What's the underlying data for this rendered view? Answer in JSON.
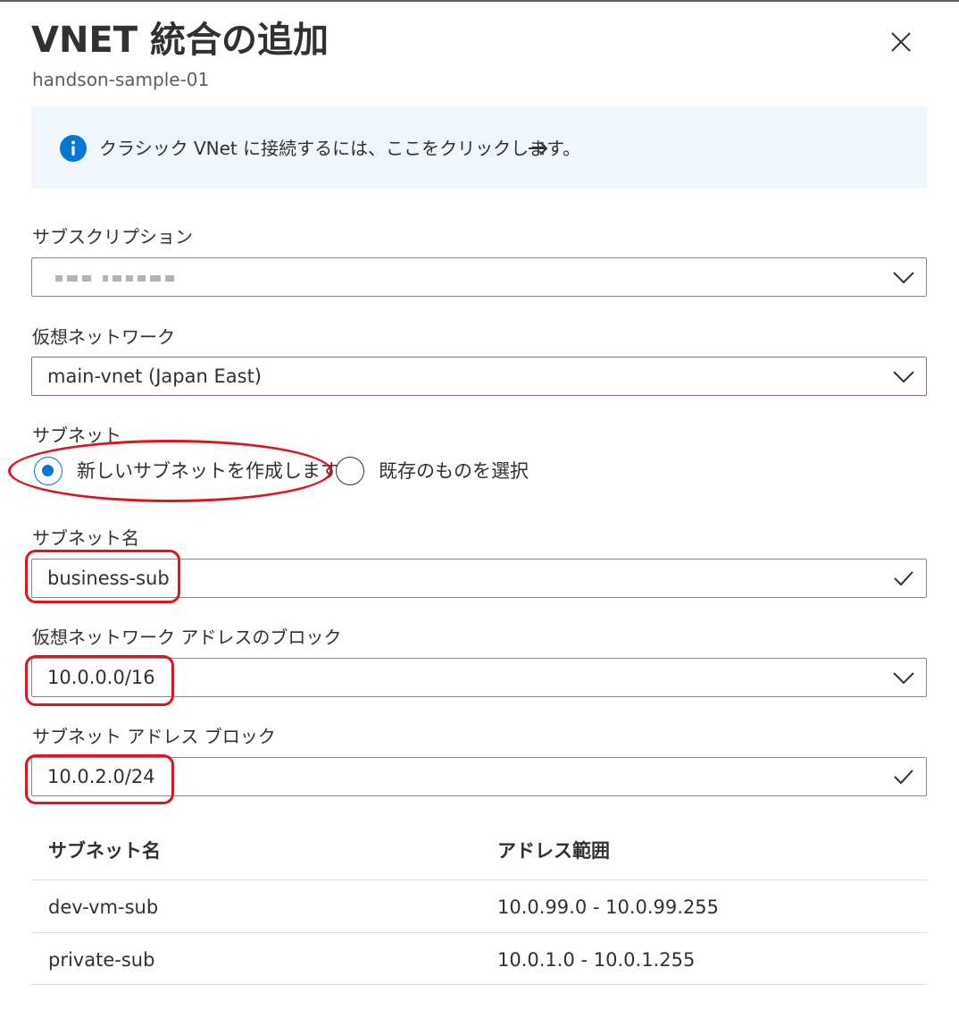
{
  "header": {
    "title": "VNET 統合の追加",
    "subtitle": "handson-sample-01",
    "close_icon": "close-icon"
  },
  "info_bar": {
    "icon": "info-icon",
    "text": "クラシック VNet に接続するには、ここをクリックします。",
    "arrow_icon": "arrow-right-icon",
    "accent_color": "#0078d4",
    "background_color": "#eff6fc"
  },
  "form": {
    "subscription": {
      "label": "サブスクリプション",
      "value_redacted": true,
      "icon": "chevron-down-icon"
    },
    "virtual_network": {
      "label": "仮想ネットワーク",
      "value": "main-vnet (Japan East)",
      "icon": "chevron-down-icon"
    },
    "subnet": {
      "label": "サブネット",
      "options": [
        {
          "label": "新しいサブネットを作成します",
          "checked": true
        },
        {
          "label": "既存のものを選択",
          "checked": false
        }
      ]
    },
    "subnet_name": {
      "label": "サブネット名",
      "value": "business-sub",
      "icon": "checkmark-icon"
    },
    "vnet_address_block": {
      "label": "仮想ネットワーク アドレスのブロック",
      "value": "10.0.0.0/16",
      "icon": "chevron-down-icon"
    },
    "subnet_address_block": {
      "label": "サブネット アドレス ブロック",
      "value": "10.0.2.0/24",
      "icon": "checkmark-icon"
    }
  },
  "subnet_table": {
    "columns": [
      "サブネット名",
      "アドレス範囲"
    ],
    "rows": [
      [
        "dev-vm-sub",
        "10.0.99.0 - 10.0.99.255"
      ],
      [
        "private-sub",
        "10.0.1.0 - 10.0.1.255"
      ]
    ]
  },
  "annotation_color": "#e0141e"
}
